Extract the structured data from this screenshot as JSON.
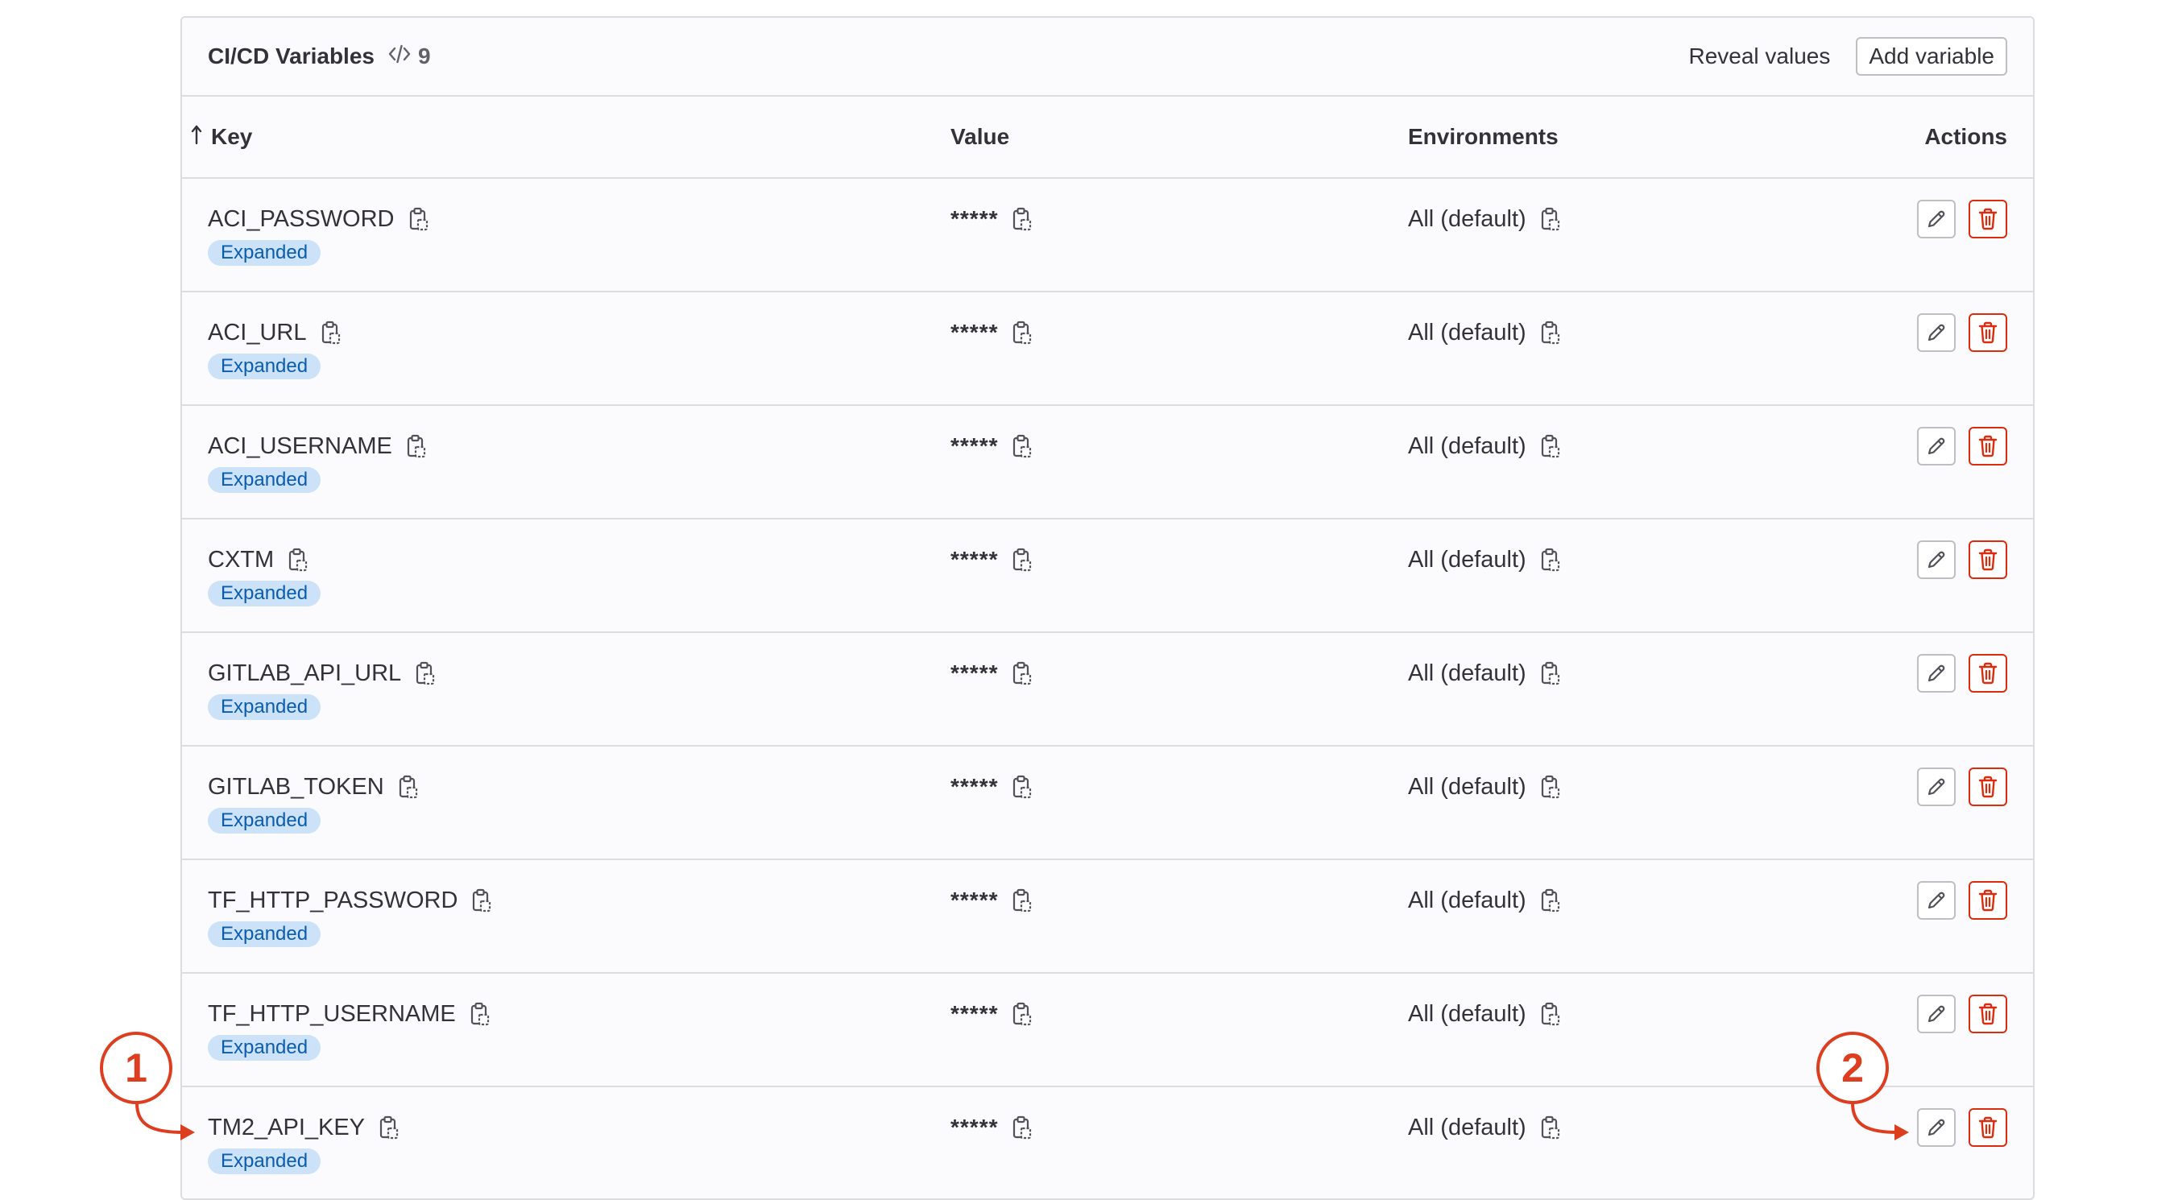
{
  "header": {
    "title": "CI/CD Variables",
    "count": "9",
    "reveal_label": "Reveal values",
    "add_label": "Add variable"
  },
  "columns": {
    "key": "Key",
    "value": "Value",
    "environments": "Environments",
    "actions": "Actions"
  },
  "rows": [
    {
      "key": "ACI_PASSWORD",
      "badge": "Expanded",
      "value": "*****",
      "env": "All (default)"
    },
    {
      "key": "ACI_URL",
      "badge": "Expanded",
      "value": "*****",
      "env": "All (default)"
    },
    {
      "key": "ACI_USERNAME",
      "badge": "Expanded",
      "value": "*****",
      "env": "All (default)"
    },
    {
      "key": "CXTM",
      "badge": "Expanded",
      "value": "*****",
      "env": "All (default)"
    },
    {
      "key": "GITLAB_API_URL",
      "badge": "Expanded",
      "value": "*****",
      "env": "All (default)"
    },
    {
      "key": "GITLAB_TOKEN",
      "badge": "Expanded",
      "value": "*****",
      "env": "All (default)"
    },
    {
      "key": "TF_HTTP_PASSWORD",
      "badge": "Expanded",
      "value": "*****",
      "env": "All (default)"
    },
    {
      "key": "TF_HTTP_USERNAME",
      "badge": "Expanded",
      "value": "*****",
      "env": "All (default)"
    },
    {
      "key": "TM2_API_KEY",
      "badge": "Expanded",
      "value": "*****",
      "env": "All (default)"
    }
  ],
  "annotations": {
    "callout_1": "1",
    "callout_2": "2"
  },
  "icons": {
    "copy": "copy-to-clipboard-icon",
    "edit": "pencil-icon",
    "delete": "trash-icon",
    "sort": "sort-arrow-up-icon",
    "code": "code-icon"
  },
  "colors": {
    "danger": "#dd2b0e",
    "badge_bg": "#cbe2f9",
    "badge_text": "#0b5cad",
    "annotation": "#dd3e1f",
    "border": "#dcdcde"
  }
}
